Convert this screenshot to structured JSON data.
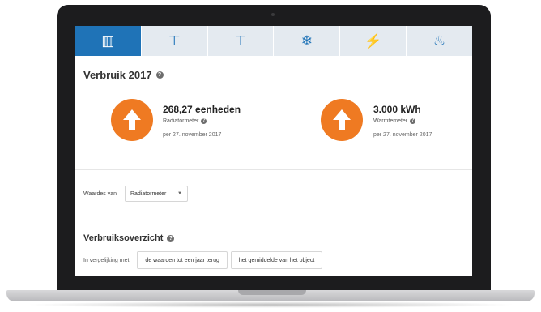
{
  "tabs": [
    {
      "icon": "radiator-icon",
      "glyph": "▥",
      "active": true
    },
    {
      "icon": "cold-water-tap-icon",
      "glyph": "⊤",
      "active": false
    },
    {
      "icon": "hot-water-tap-icon",
      "glyph": "⊤",
      "active": false
    },
    {
      "icon": "snowflake-icon",
      "glyph": "❄",
      "active": false
    },
    {
      "icon": "electricity-plug-icon",
      "glyph": "⚡",
      "active": false
    },
    {
      "icon": "gas-flame-icon",
      "glyph": "♨",
      "active": false
    }
  ],
  "colors": {
    "accent": "#1f73b7",
    "tab_bg": "#e4eaf0",
    "orange": "#ef7a22"
  },
  "page": {
    "title": "Verbruik 2017"
  },
  "meters": [
    {
      "value": "268,27 eenheden",
      "label": "Radiatormeter",
      "date": "per 27. november 2017",
      "icon": "arrow-up-icon"
    },
    {
      "value": "3.000 kWh",
      "label": "Warmtemeter",
      "date": "per 27. november 2017",
      "icon": "arrow-up-icon"
    }
  ],
  "filter": {
    "label": "Waardes van",
    "selected": "Radiatormeter"
  },
  "overview": {
    "title": "Verbruiksoverzicht",
    "compare_label": "In vergelijking met",
    "buttons": [
      "de waarden tot een jaar terug",
      "het gemiddelde van het object"
    ]
  }
}
